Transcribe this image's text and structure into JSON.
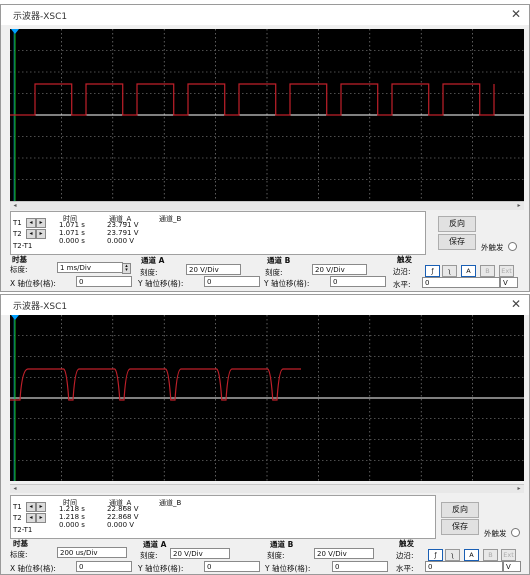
{
  "windows": [
    {
      "title": "示波器-XSC1",
      "close": "✕",
      "cursors": {
        "header_time": "时间",
        "header_a": "通道_A",
        "header_b": "通道_B",
        "rows": [
          {
            "label": "T1",
            "time": "1.071 s",
            "a": "23.791 V"
          },
          {
            "label": "T2",
            "time": "1.071 s",
            "a": "23.791 V"
          },
          {
            "label": "T2-T1",
            "time": "0.000 s",
            "a": "0.000 V"
          }
        ]
      },
      "buttons": {
        "reverse": "反向",
        "save": "保存",
        "ext_trigger": "外触发"
      },
      "timebase": {
        "title": "时基",
        "scale_label": "标度:",
        "scale_value": "1 ms/Div",
        "xpos_label": "X 轴位移(格):",
        "xpos_value": "0"
      },
      "channel_a": {
        "title": "通道 A",
        "scale_label": "刻度:",
        "scale_value": "20  V/Div",
        "ypos_label": "Y 轴位移(格):",
        "ypos_value": "0"
      },
      "channel_b": {
        "title": "通道 B",
        "scale_label": "刻度:",
        "scale_value": "20  V/Div",
        "ypos_label": "Y 轴位移(格):",
        "ypos_value": "0"
      },
      "trigger": {
        "title": "触发",
        "edge_label": "边沿:",
        "level_label": "水平:",
        "level_value": "0",
        "level_unit": "V",
        "edge_buttons": [
          "ƒ",
          "ʅ",
          "A",
          "B",
          "Ext"
        ]
      }
    },
    {
      "title": "示波器-XSC1",
      "close": "✕",
      "cursors": {
        "header_time": "时间",
        "header_a": "通道_A",
        "header_b": "通道_B",
        "rows": [
          {
            "label": "T1",
            "time": "1.218 s",
            "a": "22.868 V"
          },
          {
            "label": "T2",
            "time": "1.218 s",
            "a": "22.868 V"
          },
          {
            "label": "T2-T1",
            "time": "0.000 s",
            "a": "0.000 V"
          }
        ]
      },
      "buttons": {
        "reverse": "反向",
        "save": "保存",
        "ext_trigger": "外触发"
      },
      "timebase": {
        "title": "时基",
        "scale_label": "标度:",
        "scale_value": "200 us/Div",
        "xpos_label": "X 轴位移(格):",
        "xpos_value": "0"
      },
      "channel_a": {
        "title": "通道 A",
        "scale_label": "刻度:",
        "scale_value": "20  V/Div",
        "ypos_label": "Y 轴位移(格):",
        "ypos_value": "0"
      },
      "channel_b": {
        "title": "通道 B",
        "scale_label": "刻度:",
        "scale_value": "20  V/Div",
        "ypos_label": "Y 轴位移(格):",
        "ypos_value": "0"
      },
      "trigger": {
        "title": "触发",
        "edge_label": "边沿:",
        "level_label": "水平:",
        "level_value": "0",
        "level_unit": "V",
        "edge_buttons": [
          "ƒ",
          "ʅ",
          "A",
          "B",
          "Ext"
        ]
      }
    }
  ],
  "colors": {
    "trace_a": "#c0202a",
    "grid": "#9a9a9a",
    "baseline": "#ffffff",
    "cursor_t1": "#00a0ff",
    "cursor_t2": "#19c019"
  },
  "waveforms": [
    {
      "type": "square",
      "periods": 9,
      "high_fraction": 0.72
    },
    {
      "type": "square-rounded",
      "periods": 5,
      "high_fraction": 0.78
    }
  ]
}
